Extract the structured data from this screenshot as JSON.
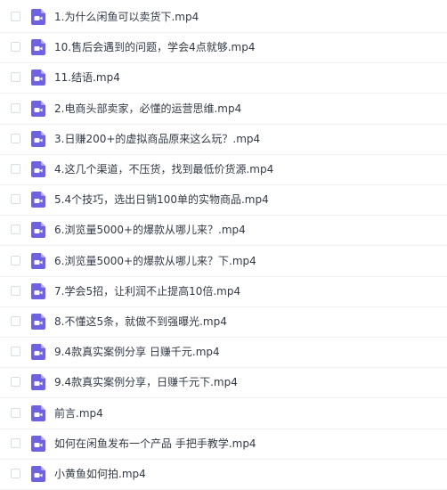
{
  "file_list": {
    "icon": "video-file-icon",
    "icon_color": "#6f62e0",
    "files": [
      {
        "name": "1.为什么闲鱼可以卖货下.mp4"
      },
      {
        "name": "10.售后会遇到的问题，学会4点就够.mp4"
      },
      {
        "name": "11.结语.mp4"
      },
      {
        "name": "2.电商头部卖家，必懂的运营思维.mp4"
      },
      {
        "name": "3.日赚200+的虚拟商品原来这么玩？.mp4"
      },
      {
        "name": "4.这几个渠道，不压货，找到最低价货源.mp4"
      },
      {
        "name": "5.4个技巧，选出日销100单的实物商品.mp4"
      },
      {
        "name": "6.浏览量5000+的爆款从哪儿来？.mp4"
      },
      {
        "name": "6.浏览量5000+的爆款从哪儿来？下.mp4"
      },
      {
        "name": "7.学会5招，让利润不止提高10倍.mp4"
      },
      {
        "name": "8.不懂这5条，就做不到强曝光.mp4"
      },
      {
        "name": "9.4款真实案例分享 日赚千元.mp4"
      },
      {
        "name": "9.4款真实案例分享，日赚千元下.mp4"
      },
      {
        "name": "前言.mp4"
      },
      {
        "name": "如何在闲鱼发布一个产品 手把手教学.mp4"
      },
      {
        "name": "小黄鱼如何拍.mp4"
      }
    ]
  }
}
